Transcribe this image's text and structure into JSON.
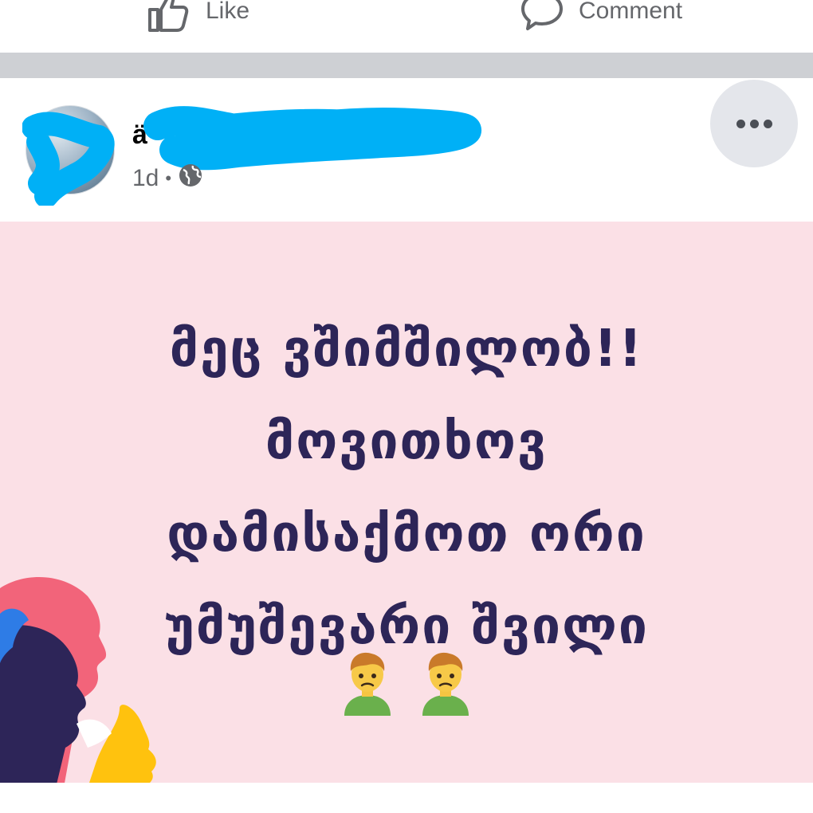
{
  "actions": {
    "like_label": "Like",
    "comment_label": "Comment"
  },
  "post": {
    "author_name": "ä",
    "timestamp": "1d",
    "separator": "•",
    "audience_icon": "globe-icon",
    "more_icon": "more-horizontal-icon",
    "text_lines": [
      "მეც ვშიმშილობ!!",
      "მოვითხოვ",
      "დამისაქმოთ ორი",
      "უმუშევარი შვილი"
    ],
    "emojis": [
      "man-frowning-emoji",
      "man-frowning-emoji"
    ],
    "background_color": "#fbe0e6",
    "text_color": "#2d2558",
    "redaction_color": "#00b0f6"
  }
}
